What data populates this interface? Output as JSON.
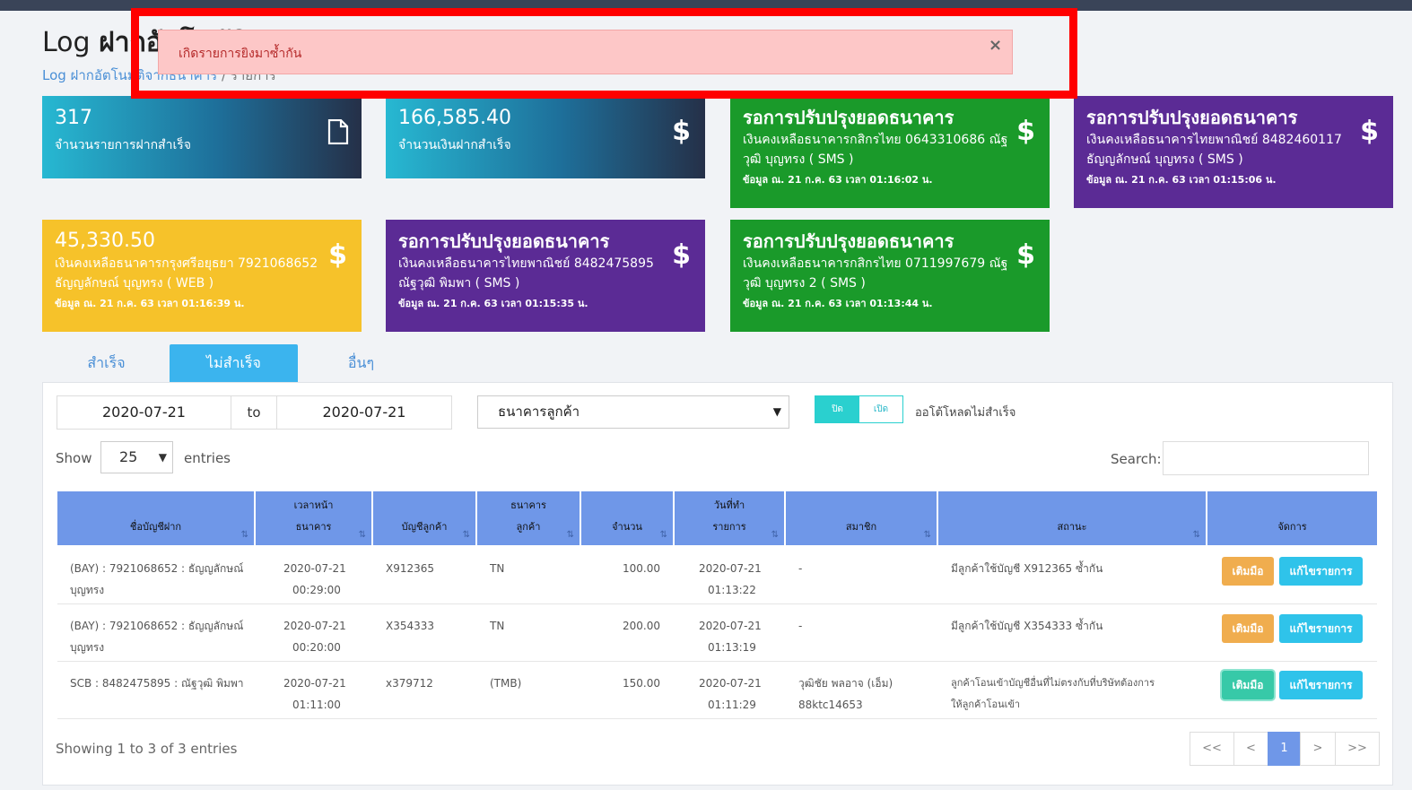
{
  "header": {
    "title_prefix": "Log",
    "title_bold": "ฝากอัตโนมัติ",
    "breadcrumb_link": "Log ฝากอัตโนมัติจากธนาคาร",
    "breadcrumb_sep": "/",
    "breadcrumb_current": "รายการ"
  },
  "alert": {
    "message": "เกิดรายการยิงมาซ้ำกัน",
    "close": "×"
  },
  "cards": [
    {
      "value": "317",
      "label": "จำนวนรายการฝากสำเร็จ",
      "icon": "document-icon"
    },
    {
      "value": "166,585.40",
      "label": "จำนวนเงินฝากสำเร็จ",
      "icon": "dollar-icon",
      "icon_glyph": "$"
    },
    {
      "title": "รอการปรับปรุงยอดธนาคาร",
      "line1": "เงินคงเหลือธนาคารกสิกรไทย 0643310686 ณัฐ",
      "line2": "วุฒิ บุญทรง ( SMS )",
      "meta": "ข้อมูล ณ. 21 ก.ค. 63 เวลา 01:16:02 น.",
      "icon_glyph": "$",
      "color": "#1a9a2a"
    },
    {
      "title": "รอการปรับปรุงยอดธนาคาร",
      "line1": "เงินคงเหลือธนาคารไทยพาณิชย์ 8482460117",
      "line2": "ธัญญลักษณ์ บุญทรง ( SMS )",
      "meta": "ข้อมูล ณ. 21 ก.ค. 63 เวลา 01:15:06 น.",
      "icon_glyph": "$",
      "color": "#5b2b95"
    },
    {
      "title": "45,330.50",
      "line1": "เงินคงเหลือธนาคารกรุงศรีอยุธยา 7921068652",
      "line2": "ธัญญลักษณ์ บุญทรง ( WEB )",
      "meta": "ข้อมูล ณ. 21 ก.ค. 63 เวลา 01:16:39 น.",
      "icon_glyph": "$",
      "color": "#f6c22a"
    },
    {
      "title": "รอการปรับปรุงยอดธนาคาร",
      "line1": "เงินคงเหลือธนาคารไทยพาณิชย์ 8482475895",
      "line2": "ณัฐวุฒิ พิมพา ( SMS )",
      "meta": "ข้อมูล ณ. 21 ก.ค. 63 เวลา 01:15:35 น.",
      "icon_glyph": "$",
      "color": "#5b2b95"
    },
    {
      "title": "รอการปรับปรุงยอดธนาคาร",
      "line1": "เงินคงเหลือธนาคารกสิกรไทย 0711997679 ณัฐ",
      "line2": "วุฒิ บุญทรง 2 ( SMS )",
      "meta": "ข้อมูล ณ. 21 ก.ค. 63 เวลา 01:13:44 น.",
      "icon_glyph": "$",
      "color": "#1a9a2a"
    }
  ],
  "tabs": [
    {
      "label": "สำเร็จ",
      "active": false
    },
    {
      "label": "ไม่สำเร็จ",
      "active": true
    },
    {
      "label": "อื่นๆ",
      "active": false
    }
  ],
  "filters": {
    "date_from": "2020-07-21",
    "to_label": "to",
    "date_to": "2020-07-21",
    "bank_select": "ธนาคารลูกค้า",
    "toggle_off": "ปิด",
    "toggle_on": "เปิด",
    "toggle_label": "ออโต้โหลดไม่สำเร็จ"
  },
  "table_controls": {
    "show": "Show",
    "page_size": "25",
    "entries": "entries",
    "search": "Search:"
  },
  "table": {
    "columns": [
      {
        "line1": "",
        "line2": "ชื่อบัญชีฝาก"
      },
      {
        "line1": "เวลาหน้า",
        "line2": "ธนาคาร"
      },
      {
        "line1": "",
        "line2": "บัญชีลูกค้า"
      },
      {
        "line1": "ธนาคาร",
        "line2": "ลูกค้า"
      },
      {
        "line1": "",
        "line2": "จำนวน"
      },
      {
        "line1": "วันที่ทำ",
        "line2": "รายการ"
      },
      {
        "line1": "",
        "line2": "สมาชิก"
      },
      {
        "line1": "",
        "line2": "สถานะ"
      },
      {
        "line1": "",
        "line2": "จัดการ"
      }
    ],
    "rows": [
      {
        "account1": "(BAY) : 7921068652 : ธัญญลักษณ์",
        "account2": "บุญทรง",
        "time1": "2020-07-21",
        "time2": "00:29:00",
        "cust_acc": "X912365",
        "cust_bank": "TN",
        "amount": "100.00",
        "date1": "2020-07-21",
        "date2": "01:13:22",
        "member1": "-",
        "member2": "",
        "status1": "มีลูกค้าใช้บัญชี X912365 ซ้ำกัน",
        "status2": "",
        "btn1": "เติมมือ",
        "btn2": "แก้ไขรายการ"
      },
      {
        "account1": "(BAY) : 7921068652 : ธัญญลักษณ์",
        "account2": "บุญทรง",
        "time1": "2020-07-21",
        "time2": "00:20:00",
        "cust_acc": "X354333",
        "cust_bank": "TN",
        "amount": "200.00",
        "date1": "2020-07-21",
        "date2": "01:13:19",
        "member1": "-",
        "member2": "",
        "status1": "มีลูกค้าใช้บัญชี X354333 ซ้ำกัน",
        "status2": "",
        "btn1": "เติมมือ",
        "btn2": "แก้ไขรายการ"
      },
      {
        "account1": "SCB : 8482475895 : ณัฐวุฒิ พิมพา",
        "account2": "",
        "time1": "2020-07-21",
        "time2": "01:11:00",
        "cust_acc": "x379712",
        "cust_bank": "(TMB)",
        "amount": "150.00",
        "date1": "2020-07-21",
        "date2": "01:11:29",
        "member1": "วุฒิชัย พลอาจ (เอ็ม)",
        "member2": "88ktc14653",
        "status1": "ลูกค้าโอนเข้าบัญชีอื่นที่ไม่ตรงกับที่บริษัทต้องการ",
        "status2": "ให้ลูกค้าโอนเข้า",
        "btn1": "เติมมือ",
        "btn2": "แก้ไขรายการ"
      }
    ]
  },
  "footer": {
    "showing": "Showing 1 to 3 of 3 entries",
    "pager": [
      "<<",
      "<",
      "1",
      ">",
      ">>"
    ]
  }
}
